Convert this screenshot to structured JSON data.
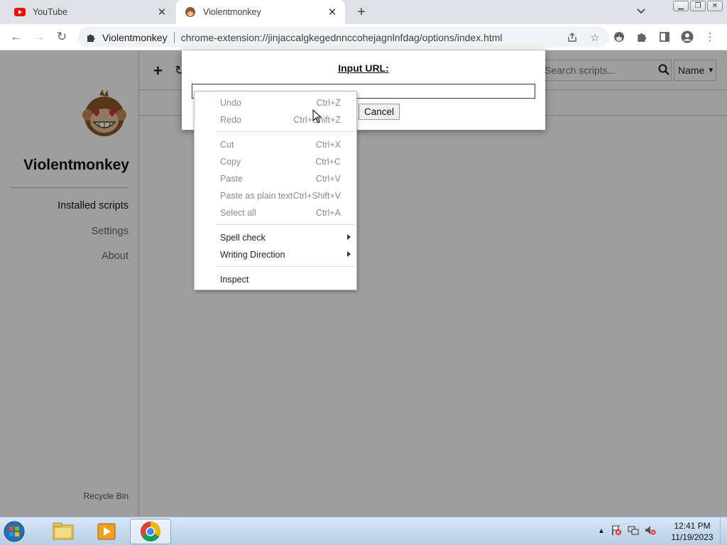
{
  "browser": {
    "tabs": [
      {
        "title": "YouTube",
        "icon": "youtube-icon"
      },
      {
        "title": "Violentmonkey",
        "icon": "violentmonkey-icon"
      }
    ],
    "address": {
      "site_label": "Violentmonkey",
      "url": "chrome-extension://jinjaccalgkegednnccohejagnlnfdag/options/index.html"
    }
  },
  "app": {
    "brand": "Violentmonkey",
    "nav": [
      {
        "label": "Installed scripts"
      },
      {
        "label": "Settings"
      },
      {
        "label": "About"
      }
    ],
    "recycle_bin": "Recycle Bin",
    "search_placeholder": "Search scripts...",
    "sort_value": "Name"
  },
  "dialog": {
    "title": "Input URL:",
    "input_value": "",
    "cancel_label": "Cancel"
  },
  "context_menu": {
    "groups": [
      [
        {
          "label": "Undo",
          "shortcut": "Ctrl+Z",
          "enabled": false
        },
        {
          "label": "Redo",
          "shortcut": "Ctrl+Shift+Z",
          "enabled": false
        }
      ],
      [
        {
          "label": "Cut",
          "shortcut": "Ctrl+X",
          "enabled": false
        },
        {
          "label": "Copy",
          "shortcut": "Ctrl+C",
          "enabled": false
        },
        {
          "label": "Paste",
          "shortcut": "Ctrl+V",
          "enabled": false
        },
        {
          "label": "Paste as plain text",
          "shortcut": "Ctrl+Shift+V",
          "enabled": false
        },
        {
          "label": "Select all",
          "shortcut": "Ctrl+A",
          "enabled": false
        }
      ],
      [
        {
          "label": "Spell check",
          "submenu": true,
          "enabled": true
        },
        {
          "label": "Writing Direction",
          "submenu": true,
          "enabled": true
        }
      ],
      [
        {
          "label": "Inspect",
          "enabled": true
        }
      ]
    ]
  },
  "taskbar": {
    "time": "12:41 PM",
    "date": "11/19/2023"
  }
}
